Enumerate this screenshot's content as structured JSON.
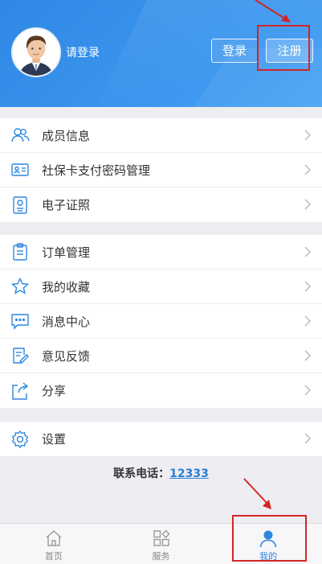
{
  "header": {
    "login_prompt": "请登录",
    "login_button": "登录",
    "register_button": "注册"
  },
  "menu_groups": [
    {
      "items": [
        {
          "label": "成员信息",
          "icon": "members-icon"
        },
        {
          "label": "社保卡支付密码管理",
          "icon": "id-card-icon"
        },
        {
          "label": "电子证照",
          "icon": "e-certificate-icon"
        }
      ]
    },
    {
      "items": [
        {
          "label": "订单管理",
          "icon": "clipboard-icon"
        },
        {
          "label": "我的收藏",
          "icon": "star-icon"
        },
        {
          "label": "消息中心",
          "icon": "message-icon"
        },
        {
          "label": "意见反馈",
          "icon": "feedback-icon"
        },
        {
          "label": "分享",
          "icon": "share-icon"
        }
      ]
    },
    {
      "items": [
        {
          "label": "设置",
          "icon": "gear-icon"
        }
      ]
    }
  ],
  "contact": {
    "label": "联系电话：",
    "phone": "12333"
  },
  "tabbar": {
    "tabs": [
      {
        "label": "首页",
        "icon": "home-icon"
      },
      {
        "label": "服务",
        "icon": "grid-icon"
      },
      {
        "label": "我的",
        "icon": "profile-icon",
        "active": true
      }
    ]
  },
  "colors": {
    "header_blue": "#3b95ee",
    "accent": "#2f86e0",
    "annotation_red": "#d42525"
  }
}
